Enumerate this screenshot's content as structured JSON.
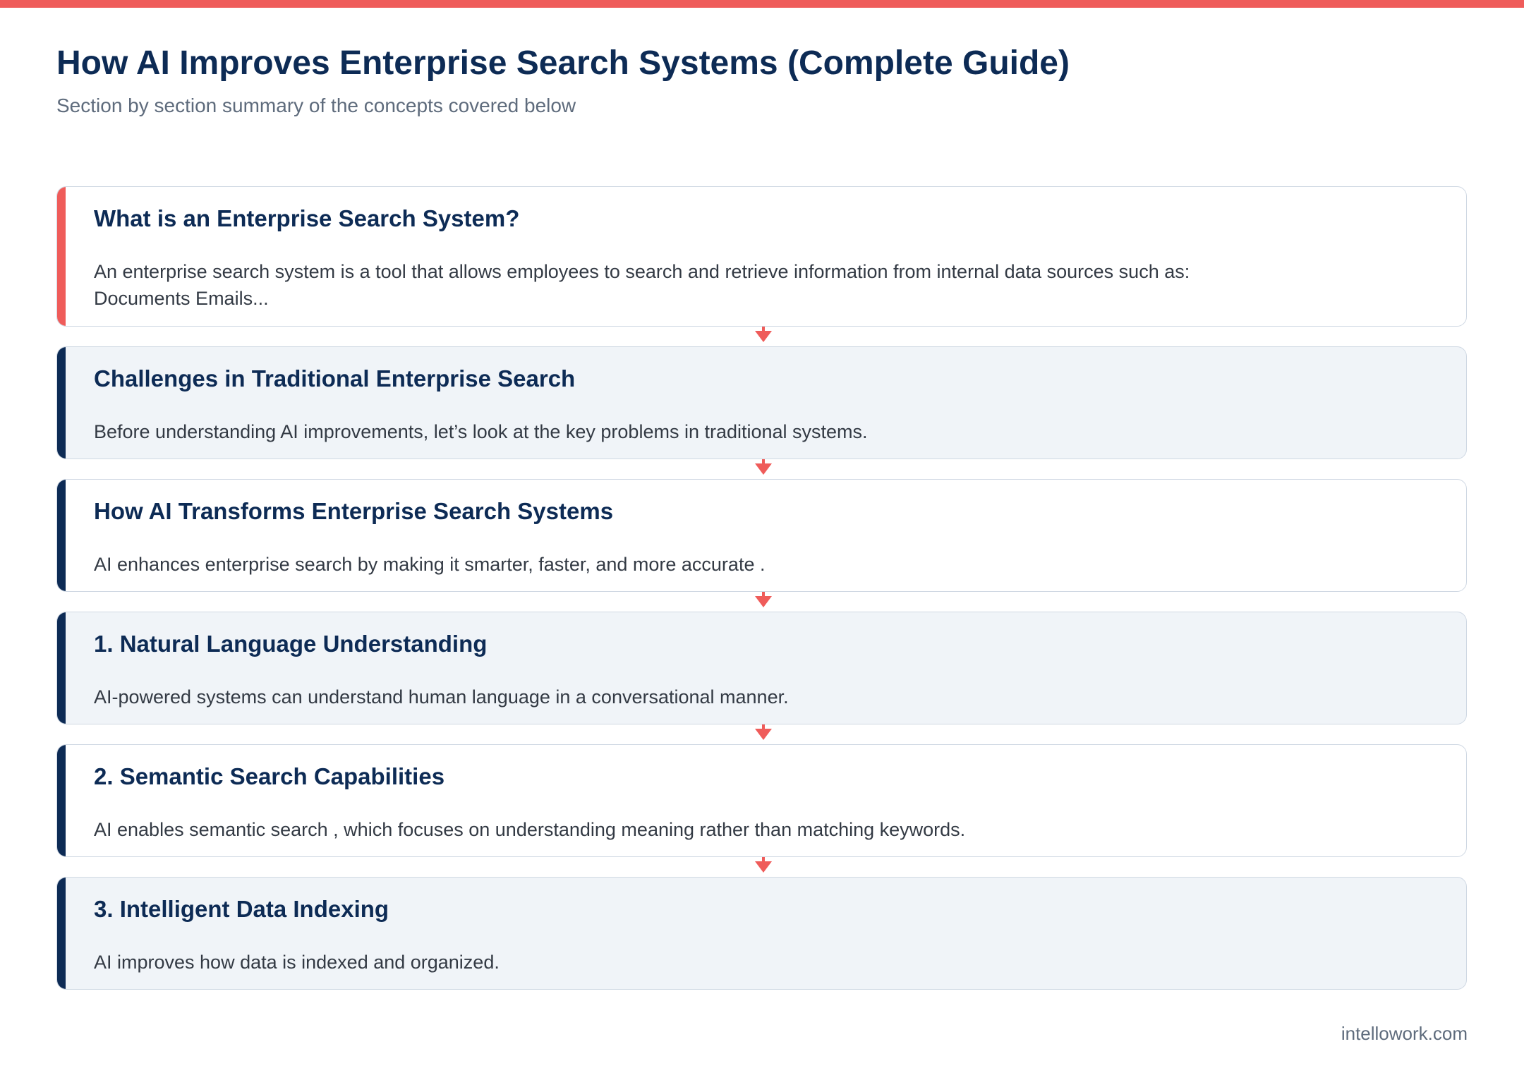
{
  "header": {
    "title": "How AI Improves Enterprise Search Systems (Complete Guide)",
    "subtitle": "Section by section summary of the concepts covered below"
  },
  "sections": [
    {
      "title": "What is an Enterprise Search System?",
      "lines": [
        "An enterprise search system is a tool that allows employees to search and retrieve information from internal data sources such as:",
        "Documents Emails..."
      ]
    },
    {
      "title": "Challenges in Traditional Enterprise Search",
      "lines": [
        "Before understanding AI improvements, let’s look at the key problems in traditional systems."
      ]
    },
    {
      "title": "How AI Transforms Enterprise Search Systems",
      "lines": [
        "AI enhances enterprise search by making it smarter, faster, and more accurate ."
      ]
    },
    {
      "title": "1. Natural Language Understanding",
      "lines": [
        "AI-powered systems can understand human language in a conversational manner."
      ]
    },
    {
      "title": "2. Semantic Search Capabilities",
      "lines": [
        "AI enables semantic search , which focuses on understanding meaning rather than matching keywords."
      ]
    },
    {
      "title": "3. Intelligent Data Indexing",
      "lines": [
        "AI improves how data is indexed and organized."
      ]
    }
  ],
  "footer": {
    "domain": "intellowork.com"
  },
  "colors": {
    "accent": "#ef5c5a",
    "navy": "#0d2b55",
    "card_alt_bg": "#f0f4f8",
    "muted_text": "#5e6b7c"
  }
}
